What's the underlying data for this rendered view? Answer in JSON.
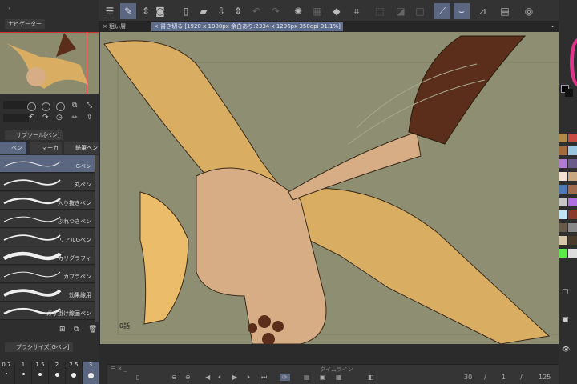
{
  "tabs": {
    "tab1": "× 粗い層",
    "tab2": "× 書き切る [1920 x 1080px 余白あり:2334 x 1296px 350dpi 91.1%]"
  },
  "navigator": {
    "title": "ナビゲーター"
  },
  "subtool": {
    "title": "サブツール[ペン]",
    "groups": [
      "ペン",
      "マーカー",
      "鉛筆ペン"
    ],
    "brushes": [
      "Gペン",
      "丸ペン",
      "入り抜きペン",
      "ぶれつきペン",
      "リアルGペン",
      "カリグラフィ",
      "カブラペン",
      "効果線用",
      "ガサ掛け線画ペン"
    ]
  },
  "brush_size": {
    "title": "ブラシサイズ[Gペン]",
    "sizes": [
      "0.7",
      "1",
      "1.5",
      "2",
      "2.5",
      "3"
    ],
    "selected": "3"
  },
  "canvas": {
    "page_label": "0話",
    "colors": {
      "bg": "#8e8e72",
      "wing": "#d9ae63",
      "body": "#d7ad85",
      "tail_tip": "#5a2e1a"
    }
  },
  "timeline": {
    "title": "タイムライン",
    "fps": "30",
    "current_frame": "1",
    "end_frame": "125",
    "sep": "/"
  },
  "palette": [
    "#b08a4a",
    "#c8493f",
    "#a36b3b",
    "#9cc6e0",
    "#b07bd0",
    "#6a5a8a",
    "#f6e2d4",
    "#c8a880",
    "#4f79b6",
    "#a06a50",
    "#c8c8c8",
    "#b070e0",
    "#c0e6f6",
    "#8a3a2a",
    "#6a5a4a",
    "#888",
    "#d8c8a8",
    "#4a3a2a",
    "#5de84a",
    "#ddd"
  ],
  "accent": "#5b6680"
}
